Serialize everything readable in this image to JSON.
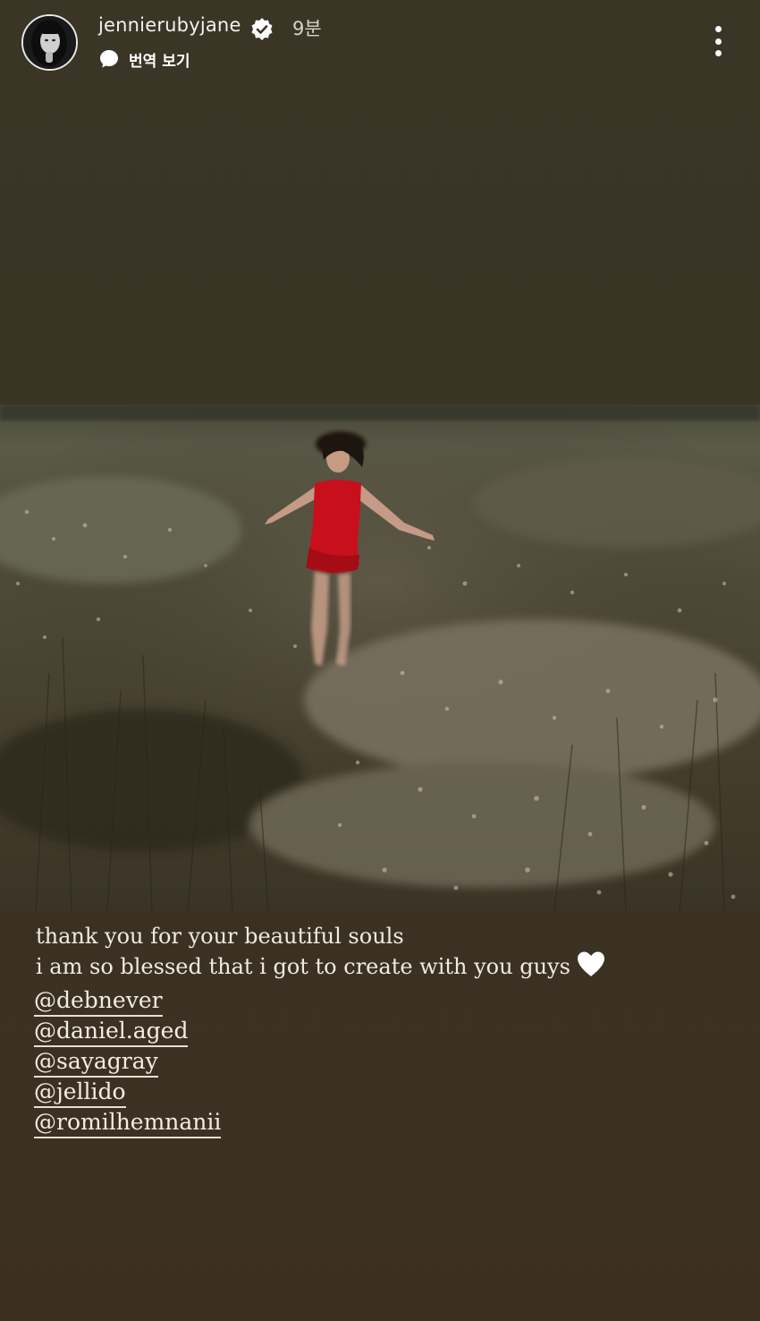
{
  "header": {
    "username": "jennierubyjane",
    "verified_icon": "verified-badge-icon",
    "time": "9분",
    "translate_label": "번역 보기",
    "translate_icon": "speech-bubble-icon",
    "more_icon": "more-vertical-icon"
  },
  "caption": {
    "line1": "thank you for your beautiful souls",
    "line2": "i am so blessed that i got to create with you guys",
    "heart_icon": "white-heart-icon"
  },
  "mentions": [
    "@debnever",
    "@daniel.aged",
    "@sayagray",
    "@jellido",
    "@romilhemnanii"
  ],
  "colors": {
    "background": "#3b3526",
    "caption_text": "#f0ebe0",
    "dress_red": "#c8101c"
  }
}
